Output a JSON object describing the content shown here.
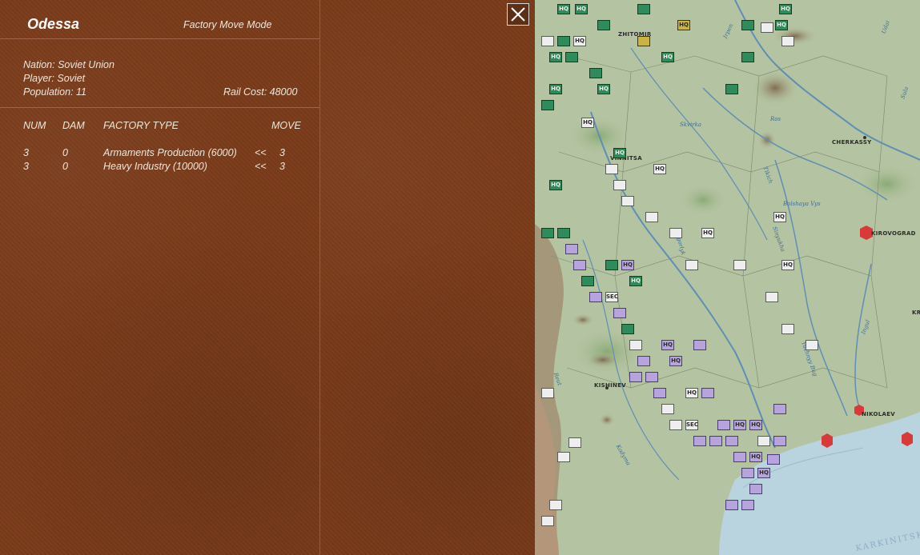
{
  "city": {
    "name": "Odessa",
    "mode": "Factory Move Mode"
  },
  "details": {
    "nation": "Nation: Soviet Union",
    "player": "Player: Soviet",
    "population": "Population: 11",
    "rail_cost": "Rail Cost: 48000"
  },
  "factory_table": {
    "headers": {
      "num": "NUM",
      "dam": "DAM",
      "type": "FACTORY TYPE",
      "move": "MOVE"
    },
    "rows": [
      {
        "num": "3",
        "dam": "0",
        "type": "Armaments Production (6000)",
        "arrow": "<<",
        "move": "3"
      },
      {
        "num": "3",
        "dam": "0",
        "type": "Heavy Industry (10000)",
        "arrow": "<<",
        "move": "3"
      }
    ]
  },
  "map": {
    "cities": [
      "ZHITOMIR",
      "VINNITSA",
      "CHERKASSY",
      "KIROVOGRAD",
      "KISHINEV",
      "NIKOLAEV",
      "KR"
    ],
    "rivers": [
      "Skvirka",
      "Ros",
      "Bolshaya Vys",
      "Sinyukha",
      "Yagorlyk",
      "Ingul",
      "Yuzhnyy Bug",
      "Tikich",
      "Irpen",
      "Sula",
      "Udai",
      "Kodyma",
      "Reut"
    ],
    "sea_label": "KARKINITSK",
    "unit_labels": {
      "hq": "HQ",
      "sec": "SEC"
    },
    "colors": {
      "land": "#b4c3a1",
      "sea": "#b9d3df",
      "river": "#5f8fb5",
      "enemy_hex": "#d83a3a"
    }
  },
  "colors": {
    "panel": "#7a3b1a",
    "panel_text": "#efe6da",
    "divider": "#a0644a"
  }
}
